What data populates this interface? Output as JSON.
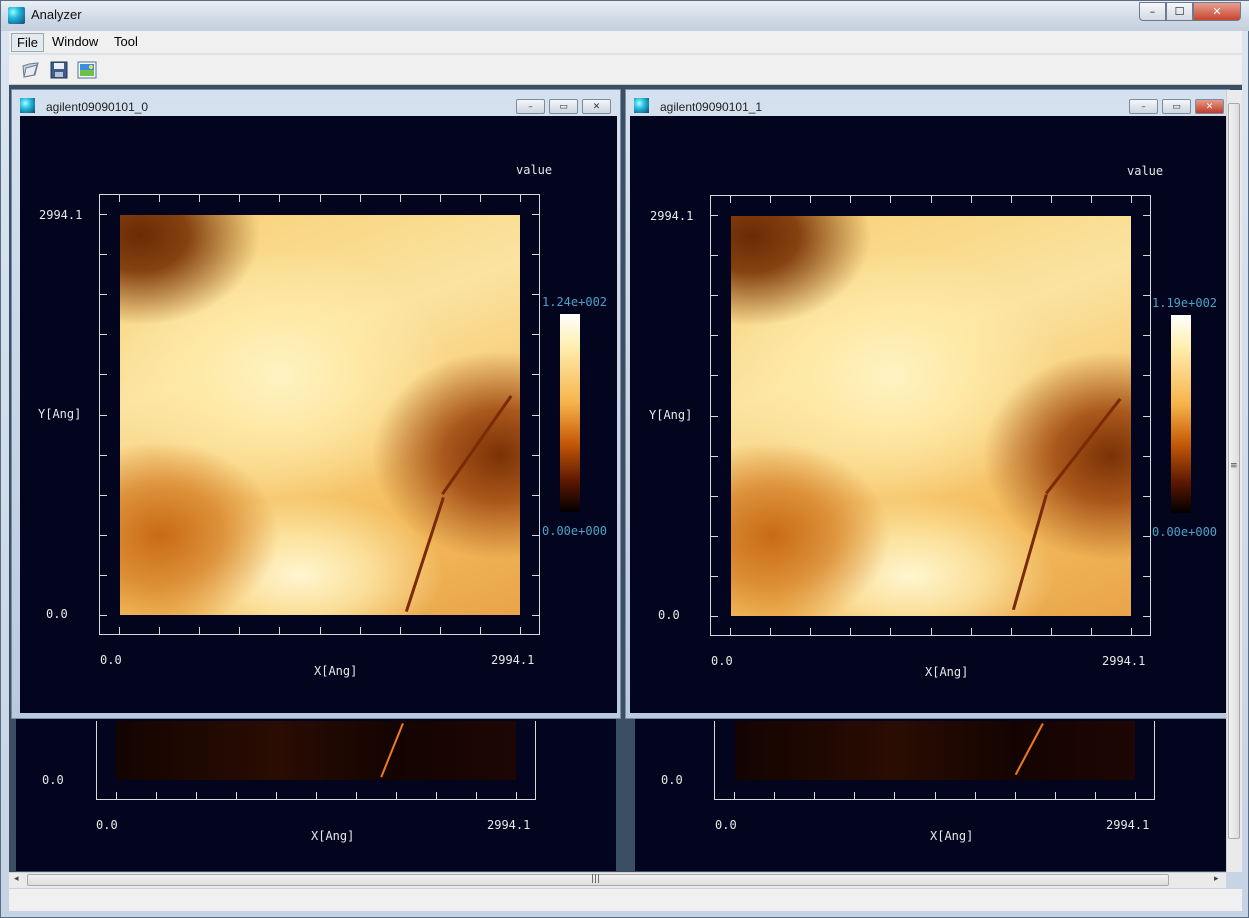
{
  "app": {
    "title": "Analyzer",
    "window_controls": {
      "minimize": "–",
      "maximize": "☐",
      "close": "✕"
    }
  },
  "menu": {
    "items": [
      "File",
      "Window",
      "Tool"
    ]
  },
  "toolbar": {
    "icons": [
      "open-folder-icon",
      "save-disk-icon",
      "image-icon"
    ]
  },
  "windows": [
    {
      "title": "agilent09090101_0",
      "value_label": "value",
      "cbar_max": "1.24e+002",
      "cbar_min": "0.00e+000",
      "y_max": "2994.1",
      "y_min": "0.0",
      "ylabel": "Y[Ang]",
      "x_min": "0.0",
      "x_max": "2994.1",
      "xlabel": "X[Ang]",
      "controls": {
        "minimize": "–",
        "restore": "▭",
        "close": "✕"
      }
    },
    {
      "title": "agilent09090101_1",
      "value_label": "value",
      "cbar_max": "1.19e+002",
      "cbar_min": "0.00e+000",
      "y_max": "2994.1",
      "y_min": "0.0",
      "ylabel": "Y[Ang]",
      "x_min": "0.0",
      "x_max": "2994.1",
      "xlabel": "X[Ang]",
      "controls": {
        "minimize": "–",
        "restore": "▭",
        "close": "✕"
      }
    }
  ],
  "lower_windows": [
    {
      "y_min": "0.0",
      "x_min": "0.0",
      "x_max": "2994.1",
      "xlabel": "X[Ang]"
    },
    {
      "y_min": "0.0",
      "x_min": "0.0",
      "x_max": "2994.1",
      "xlabel": "X[Ang]"
    }
  ],
  "scroll": {
    "left_arrow": "◂",
    "right_arrow": "▸",
    "grip_h": "|||",
    "grip_v": "≡"
  }
}
